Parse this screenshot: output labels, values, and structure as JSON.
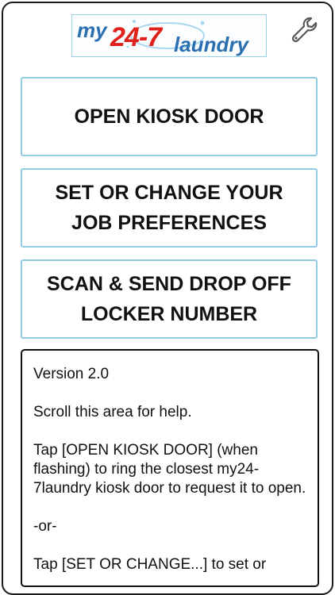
{
  "logo": {
    "my": "my",
    "num": "24-7",
    "laundry": "laundry"
  },
  "icons": {
    "settings": "wrench-icon"
  },
  "buttons": {
    "open_door": "OPEN KIOSK DOOR",
    "preferences_line1": "SET OR CHANGE YOUR",
    "preferences_line2": "JOB PREFERENCES",
    "scan_line1": "SCAN & SEND DROP OFF",
    "scan_line2": "LOCKER NUMBER"
  },
  "help": {
    "version": "Version 2.0",
    "scroll_hint": "Scroll this area for help.",
    "open_door_help": "Tap [OPEN KIOSK DOOR] (when flashing) to ring the closest my24-7laundry kiosk door to request it to open.",
    "or": "-or-",
    "preferences_help": "Tap [SET OR CHANGE...] to set or"
  },
  "colors": {
    "accent_blue": "#8fcbe3",
    "brand_red": "#e0211b",
    "brand_blue": "#2a6fb0"
  }
}
